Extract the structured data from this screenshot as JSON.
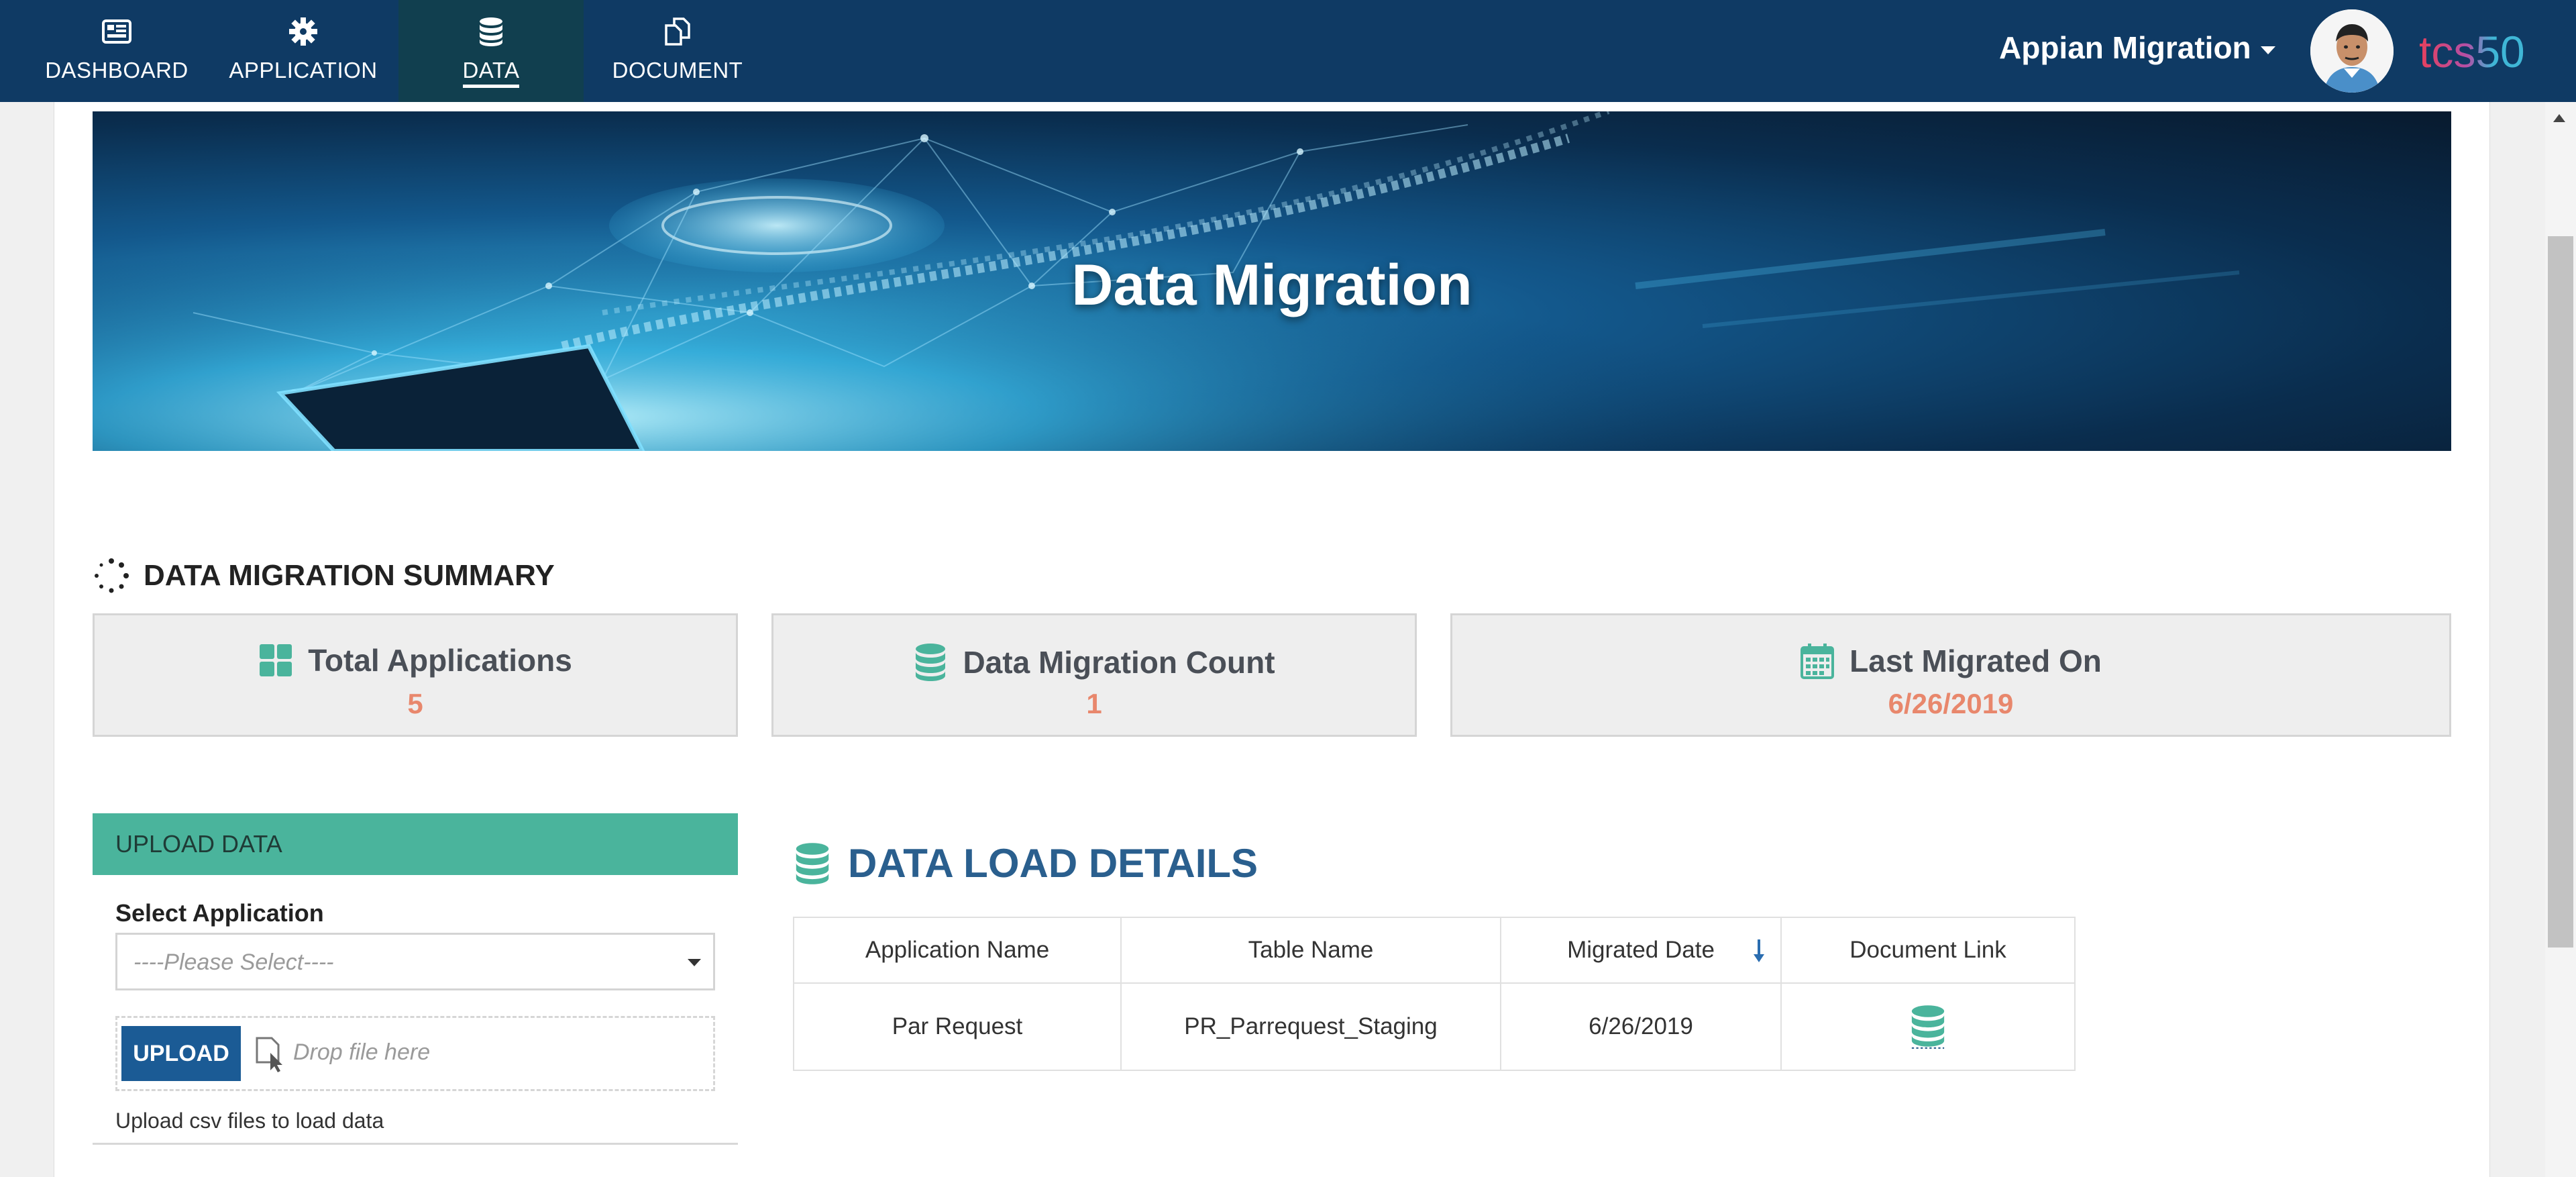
{
  "nav": {
    "items": [
      {
        "label": "DASHBOARD",
        "icon": "dashboard-icon"
      },
      {
        "label": "APPLICATION",
        "icon": "gear-icon"
      },
      {
        "label": "DATA",
        "icon": "database-icon",
        "active": true
      },
      {
        "label": "DOCUMENT",
        "icon": "copy-document-icon"
      }
    ],
    "user_label": "Appian Migration",
    "brand_text": "tcs50"
  },
  "banner": {
    "title": "Data Migration"
  },
  "summary": {
    "title": "DATA MIGRATION SUMMARY",
    "cards": [
      {
        "label": "Total Applications",
        "value": "5",
        "icon": "grid-icon"
      },
      {
        "label": "Data Migration Count",
        "value": "1",
        "icon": "database-icon"
      },
      {
        "label": "Last Migrated On",
        "value": "6/26/2019",
        "icon": "calendar-icon"
      }
    ]
  },
  "upload": {
    "header": "UPLOAD DATA",
    "select_label": "Select Application",
    "select_value": "----Please Select----",
    "button_label": "UPLOAD",
    "drop_text": "Drop file here",
    "hint": "Upload csv files to load data"
  },
  "details": {
    "title": "DATA LOAD DETAILS",
    "columns": [
      "Application Name",
      "Table Name",
      "Migrated Date",
      "Document Link"
    ],
    "rows": [
      {
        "application": "Par Request",
        "table": "PR_Parrequest_Staging",
        "date": "6/26/2019",
        "link_icon": "database-icon"
      }
    ]
  },
  "colors": {
    "nav_bg": "#0f3a64",
    "accent_teal": "#4ab49c",
    "value_orange": "#e8876c",
    "title_blue": "#2a5f8e",
    "button_blue": "#1b5b95"
  }
}
